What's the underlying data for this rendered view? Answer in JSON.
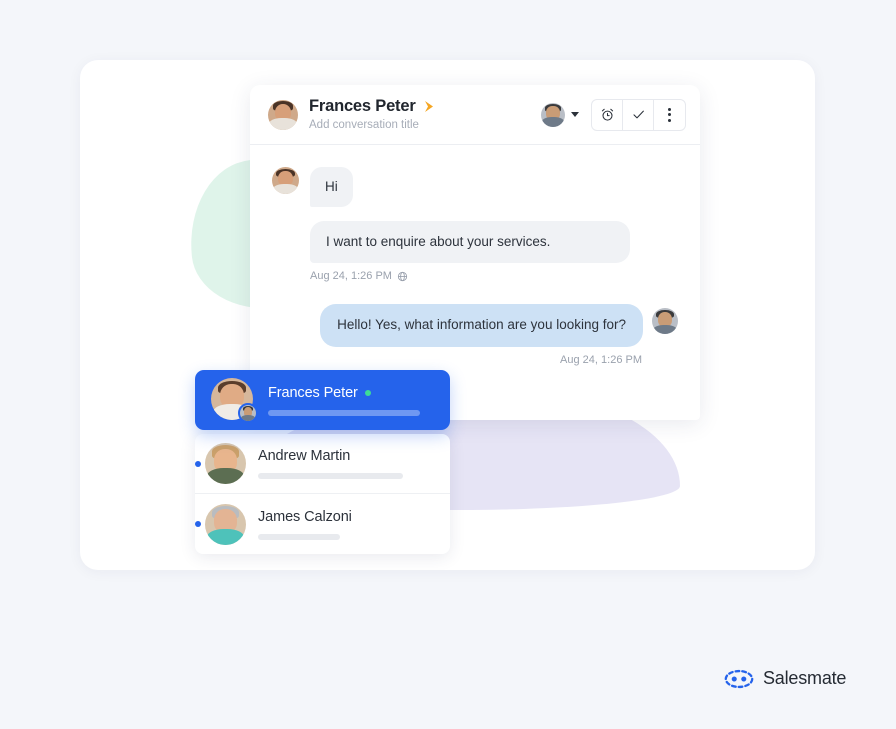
{
  "page": {
    "background_color": "#f4f6fa",
    "card_background": "#ffffff"
  },
  "colors": {
    "accent_blue": "#2563eb",
    "bubble_incoming": "#f0f2f5",
    "bubble_outgoing": "#cde1f5",
    "online_green": "#3ddc97",
    "arrow_yellow": "#f5a623",
    "blob_green": "#d9f2e6",
    "blob_purple": "#dedbf2"
  },
  "chat": {
    "header": {
      "contact_name": "Frances Peter",
      "subtitle": "Add conversation title",
      "arrow_icon": "forward-arrow-icon",
      "avatar_icon": "contact-avatar",
      "assignee_avatar_icon": "assignee-avatar",
      "caret_icon": "chevron-down-icon",
      "actions": [
        {
          "icon": "alarm-clock-icon",
          "label": "Snooze"
        },
        {
          "icon": "check-icon",
          "label": "Resolve"
        },
        {
          "icon": "more-vertical-icon",
          "label": "More options"
        }
      ]
    },
    "messages": [
      {
        "direction": "incoming",
        "text": "Hi",
        "avatar_icon": "contact-avatar",
        "show_avatar": true
      },
      {
        "direction": "incoming",
        "text": "I want to enquire about your services.",
        "show_avatar": false,
        "timestamp": "Aug 24, 1:26 PM",
        "channel_icon": "globe-icon"
      },
      {
        "direction": "outgoing",
        "text": "Hello! Yes, what information are you looking for?",
        "avatar_icon": "agent-avatar",
        "timestamp": "Aug 24, 1:26 PM"
      }
    ]
  },
  "contact_list": {
    "selected": {
      "name": "Frances Peter",
      "status": "online",
      "status_dot_icon": "online-status-dot",
      "avatar_icon": "contact-avatar",
      "badge_avatar_icon": "agent-avatar-badge",
      "preview_placeholder": ""
    },
    "items": [
      {
        "name": "Andrew Martin",
        "unread": true,
        "unread_dot_icon": "unread-dot-icon",
        "avatar_icon": "andrew-avatar",
        "preview_width": 145
      },
      {
        "name": "James Calzoni",
        "unread": true,
        "unread_dot_icon": "unread-dot-icon",
        "avatar_icon": "james-avatar",
        "preview_width": 82
      }
    ]
  },
  "branding": {
    "name": "Salesmate",
    "logo_icon": "salesmate-logo-icon"
  }
}
